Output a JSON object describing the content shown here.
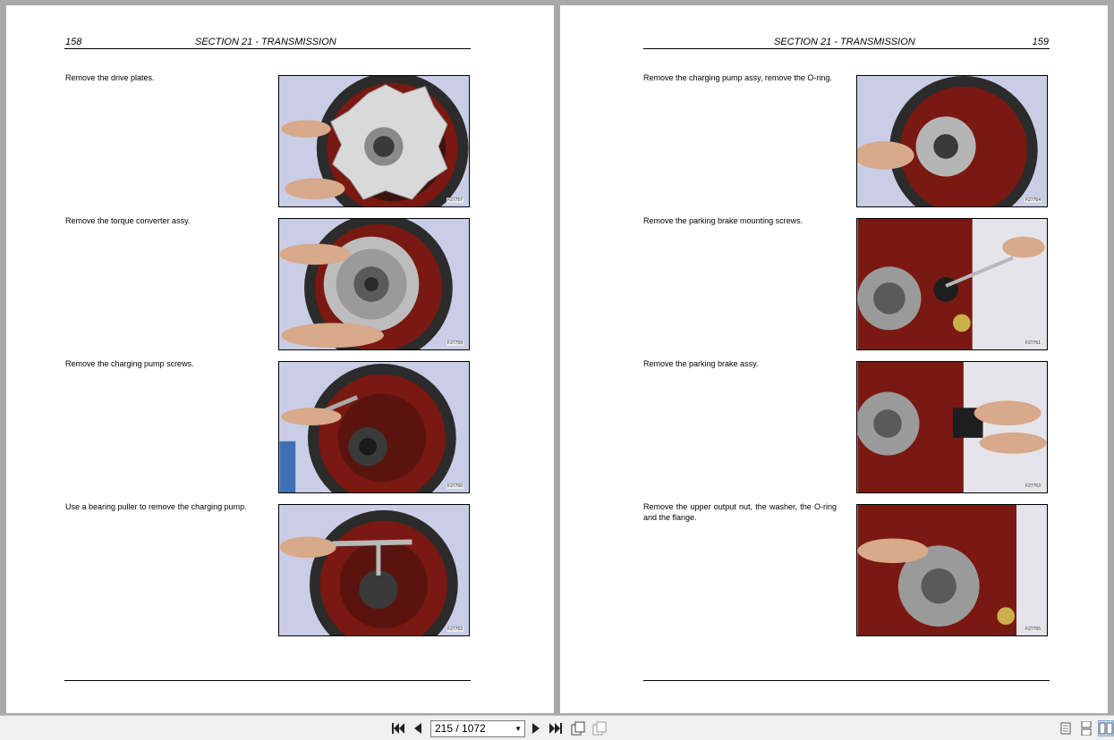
{
  "viewer": {
    "left_page": {
      "page_number": "158",
      "section": "SECTION 21 - TRANSMISSION",
      "steps": [
        {
          "text": "Remove the drive plates.",
          "figure": "F27757"
        },
        {
          "text": "Remove the torque converter assy.",
          "figure": "F27759"
        },
        {
          "text": "Remove the charging pump screws.",
          "figure": "F27760"
        },
        {
          "text": "Use a bearing puller to remove the charging pump.",
          "figure": "F27762"
        }
      ]
    },
    "right_page": {
      "page_number": "159",
      "section": "SECTION 21 - TRANSMISSION",
      "steps": [
        {
          "text": "Remove the charging pump assy, remove the O-ring.",
          "figure": "F27764"
        },
        {
          "text": "Remove the parking brake mounting screws.",
          "figure": "F27761"
        },
        {
          "text": "Remove the parking brake assy.",
          "figure": "F27763"
        },
        {
          "text": "Remove the upper output nut, the washer, the O-ring and the flange.",
          "figure": "F27765"
        }
      ]
    }
  },
  "toolbar": {
    "page_indicator": "215 / 1072",
    "icons": [
      "first-page-icon",
      "previous-page-icon",
      "next-page-icon",
      "last-page-icon",
      "rotate-icon",
      "copy-icon",
      "single-page-view-icon",
      "continuous-view-icon",
      "two-page-view-icon"
    ]
  },
  "colors": {
    "background": "#a9a9a9",
    "page": "#ffffff",
    "housing_red": "#8a1a14",
    "photo_bg": "#cfd3ea",
    "toolbar": "#f0f0f0"
  }
}
